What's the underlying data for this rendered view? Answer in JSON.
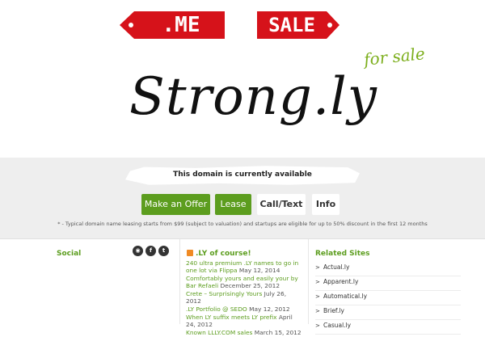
{
  "tags": {
    "me": ".ME",
    "sale": "SALE"
  },
  "logo": {
    "text": "Strong.ly",
    "for_sale": "for sale"
  },
  "availability": "This domain is currently available",
  "buttons": {
    "offer": "Make an Offer",
    "lease": "Lease",
    "call": "Call/Text",
    "info": "Info"
  },
  "note": "* - Typical domain name leasing starts from $99 (subject to valuation) and startups are eligible for up to 50% discount in the first 12 months",
  "social": {
    "title": "Social",
    "icons": [
      "rss-icon",
      "facebook-icon",
      "twitter-icon"
    ]
  },
  "news": {
    "title": ".LY of course!",
    "items": [
      {
        "title": "240 ultra premium .LY names to go in one lot via Flippa",
        "date": "May 12, 2014"
      },
      {
        "title": "Comfortably yours and easily your by Bar Refaeli",
        "date": "December 25, 2012"
      },
      {
        "title": "Crete – Surprisingly Yours",
        "date": "July 26, 2012"
      },
      {
        "title": ".LY Portfolio @ SEDO",
        "date": "May 12, 2012"
      },
      {
        "title": "When LY suffix meets LY prefix",
        "date": "April 24, 2012"
      },
      {
        "title": "Known LLLY.COM sales",
        "date": "March 15, 2012"
      }
    ]
  },
  "related": {
    "title": "Related Sites",
    "items": [
      "Actual.ly",
      "Apparent.ly",
      "Automatical.ly",
      "Brief.ly",
      "Casual.ly"
    ]
  }
}
